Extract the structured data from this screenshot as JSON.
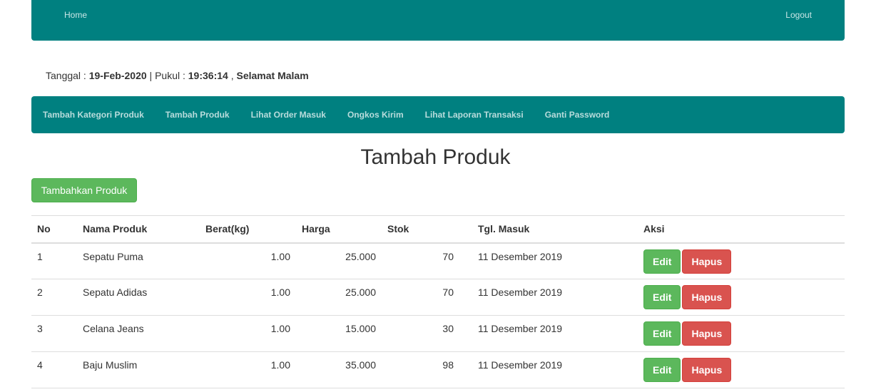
{
  "topbar": {
    "home": "Home",
    "logout": "Logout"
  },
  "datetime": {
    "date_label": "Tanggal : ",
    "date": "19-Feb-2020",
    "time_label": " | Pukul : ",
    "time": "19:36:14",
    "sep": " , ",
    "greeting": "Selamat Malam"
  },
  "nav": [
    "Tambah Kategori Produk",
    "Tambah Produk",
    "Lihat Order Masuk",
    "Ongkos Kirim",
    "Lihat Laporan Transaksi",
    "Ganti Password"
  ],
  "page_title": "Tambah Produk",
  "add_button": "Tambahkan Produk",
  "table": {
    "headers": [
      "No",
      "Nama Produk",
      "Berat(kg)",
      "Harga",
      "Stok",
      "Tgl. Masuk",
      "Aksi"
    ],
    "rows": [
      [
        "1",
        "Sepatu Puma",
        "1.00",
        "25.000",
        "70",
        "11 Desember 2019"
      ],
      [
        "2",
        "Sepatu Adidas",
        "1.00",
        "25.000",
        "70",
        "11 Desember 2019"
      ],
      [
        "3",
        "Celana Jeans",
        "1.00",
        "15.000",
        "30",
        "11 Desember 2019"
      ],
      [
        "4",
        "Baju Muslim",
        "1.00",
        "35.000",
        "98",
        "11 Desember 2019"
      ]
    ],
    "edit_label": "Edit",
    "delete_label": "Hapus"
  },
  "colors": {
    "teal": "#008080",
    "success": "#5cb85c",
    "danger": "#d9534f"
  }
}
